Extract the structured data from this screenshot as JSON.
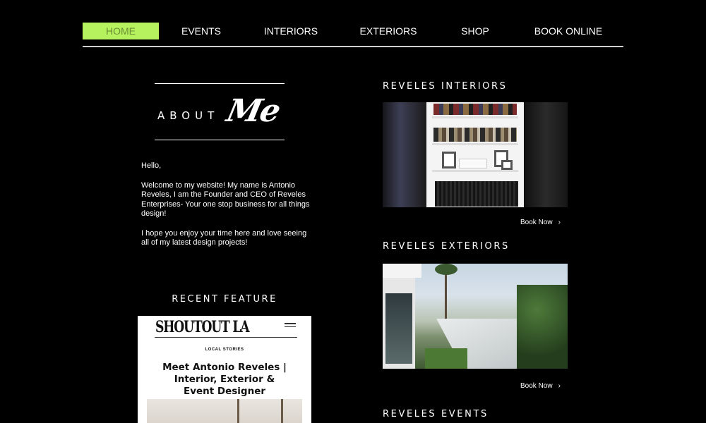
{
  "nav": {
    "items": [
      {
        "label": "HOME",
        "active": true
      },
      {
        "label": "EVENTS",
        "active": false
      },
      {
        "label": "INTERIORS",
        "active": false
      },
      {
        "label": "EXTERIORS",
        "active": false
      },
      {
        "label": "SHOP",
        "active": false
      },
      {
        "label": "BOOK ONLINE",
        "active": false
      }
    ],
    "active_color": "#b6f25d"
  },
  "about": {
    "heading_word": "ABOUT",
    "heading_script": "Me",
    "paragraphs": [
      "Hello,",
      "Welcome to my website! My name is Antonio Reveles, I am the Founder and CEO of Reveles Enterprises- Your one stop business for all things design!",
      "I hope you enjoy your time here and love seeing all of my latest design projects!"
    ]
  },
  "recent_feature": {
    "title": "RECENT FEATURE",
    "card": {
      "logo": "SHOUTOUT LA",
      "kicker": "LOCAL STORIES",
      "headline": "Meet Antonio Reveles | Interior, Exterior & Event Designer"
    }
  },
  "sections": {
    "interiors": {
      "title": "REVELES INTERIORS",
      "book_label": "Book Now"
    },
    "exteriors": {
      "title": "REVELES EXTERIORS",
      "book_label": "Book Now"
    },
    "events": {
      "title": "REVELES EVENTS"
    }
  }
}
